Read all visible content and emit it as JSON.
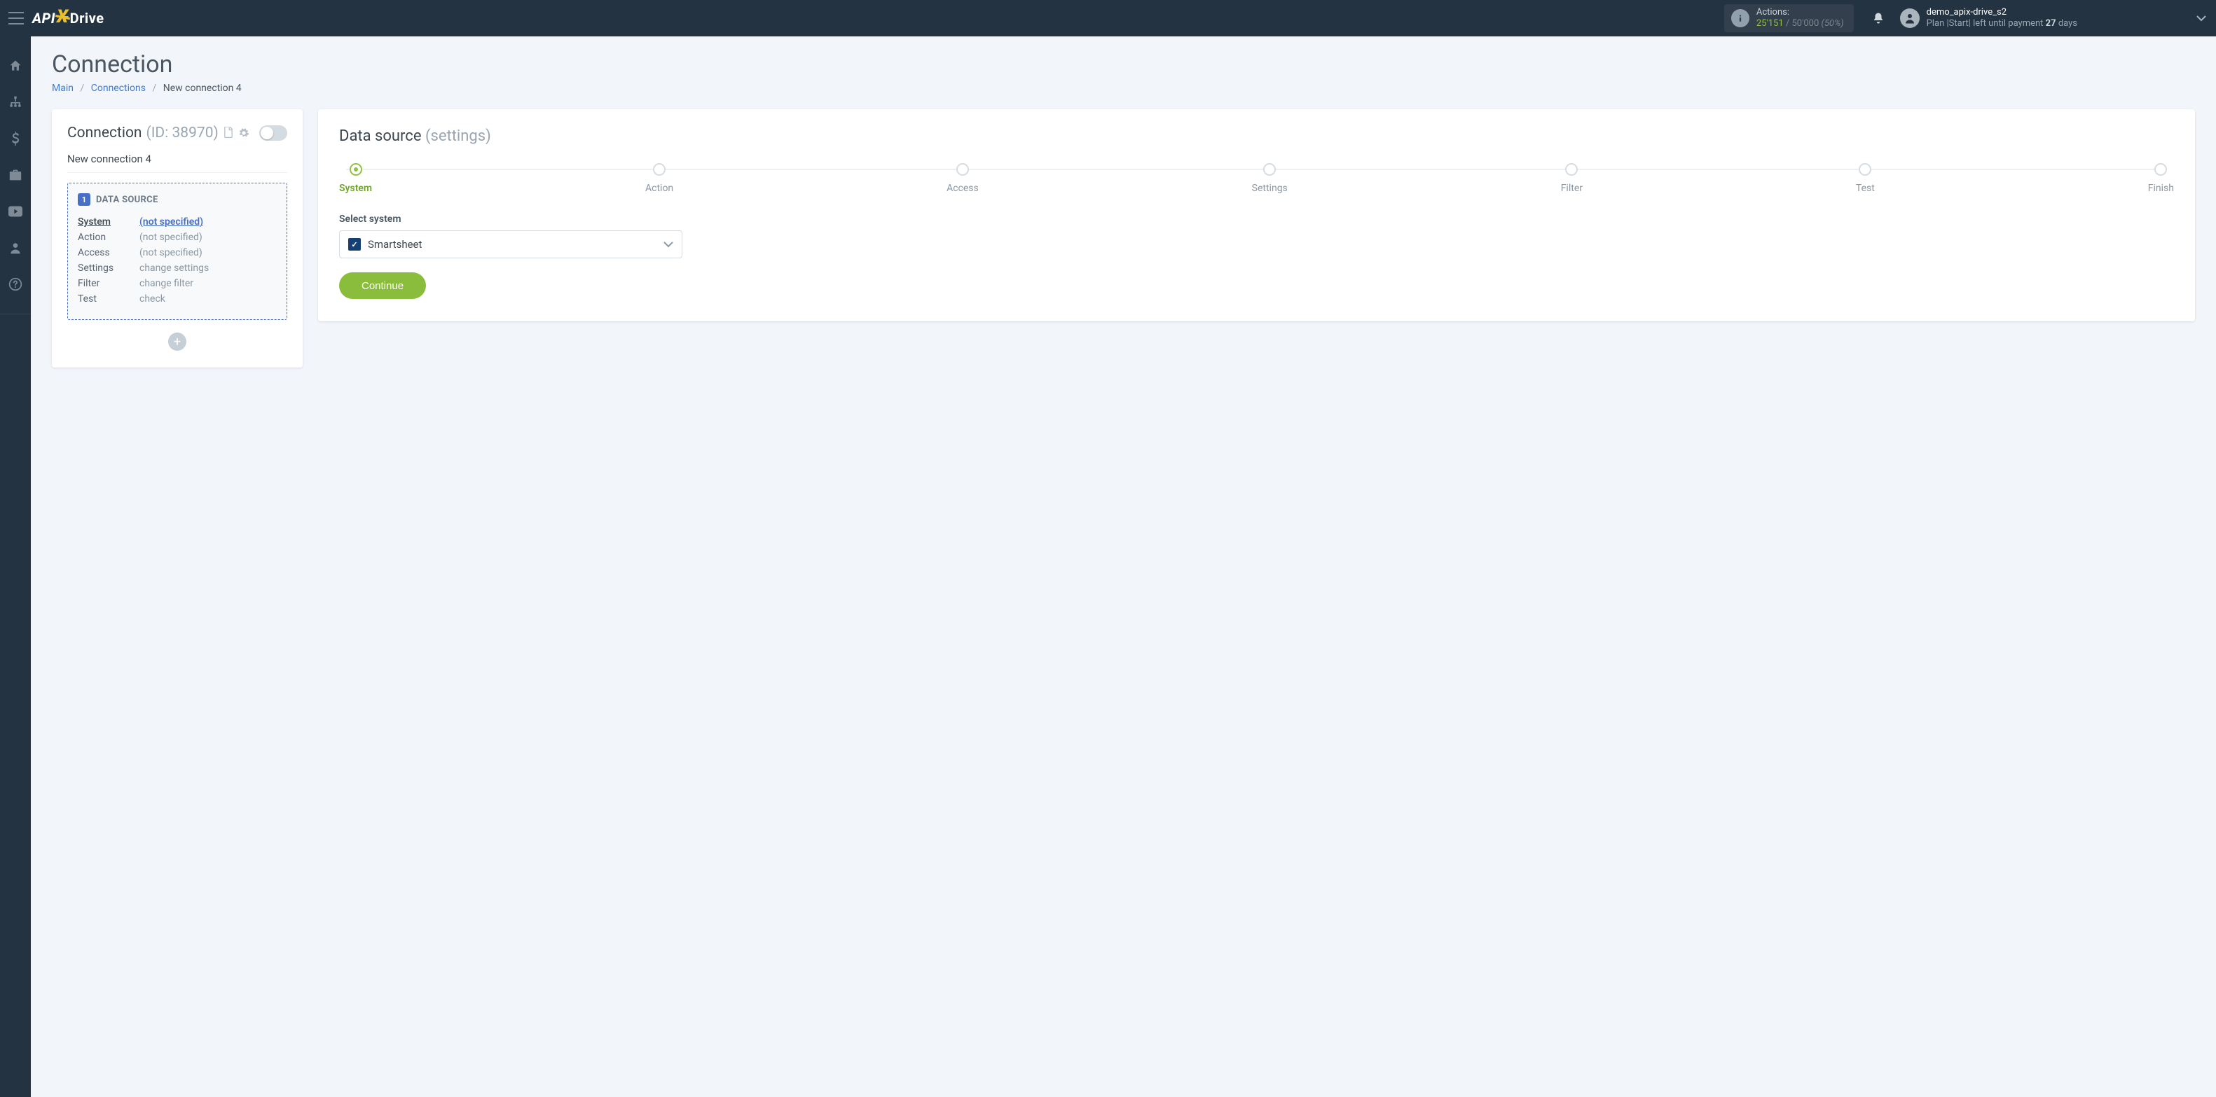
{
  "header": {
    "logo_left": "API",
    "logo_sep": "X",
    "logo_right": "Drive",
    "actions": {
      "label": "Actions:",
      "used": "25'151",
      "sep": " / ",
      "total": "50'000",
      "pct": "(50%)"
    },
    "user": {
      "name": "demo_apix-drive_s2",
      "plan_pre": "Plan |Start| left until payment ",
      "plan_days_num": "27",
      "plan_days_suffix": " days"
    }
  },
  "sidebar": {
    "items": [
      {
        "name": "sidebar-home"
      },
      {
        "name": "sidebar-connections"
      },
      {
        "name": "sidebar-billing"
      },
      {
        "name": "sidebar-briefcase"
      },
      {
        "name": "sidebar-youtube"
      },
      {
        "name": "sidebar-account"
      },
      {
        "name": "sidebar-help"
      }
    ]
  },
  "page": {
    "title": "Connection",
    "breadcrumb": {
      "main": "Main",
      "connections": "Connections",
      "current": "New connection 4"
    }
  },
  "left_card": {
    "title": "Connection",
    "id": "(ID: 38970)",
    "conn_name": "New connection 4",
    "ds_header": "DATA SOURCE",
    "rows": [
      {
        "label": "System",
        "value": "(not specified)",
        "current": true
      },
      {
        "label": "Action",
        "value": "(not specified)"
      },
      {
        "label": "Access",
        "value": "(not specified)"
      },
      {
        "label": "Settings",
        "value": "change settings"
      },
      {
        "label": "Filter",
        "value": "change filter"
      },
      {
        "label": "Test",
        "value": "check"
      }
    ]
  },
  "right_card": {
    "title": "Data source",
    "subtitle": "(settings)",
    "steps": [
      {
        "label": "System",
        "active": true
      },
      {
        "label": "Action",
        "active": false
      },
      {
        "label": "Access",
        "active": false
      },
      {
        "label": "Settings",
        "active": false
      },
      {
        "label": "Filter",
        "active": false
      },
      {
        "label": "Test",
        "active": false
      },
      {
        "label": "Finish",
        "active": false
      }
    ],
    "form_label": "Select system",
    "select_value": "Smartsheet",
    "continue_label": "Continue"
  }
}
